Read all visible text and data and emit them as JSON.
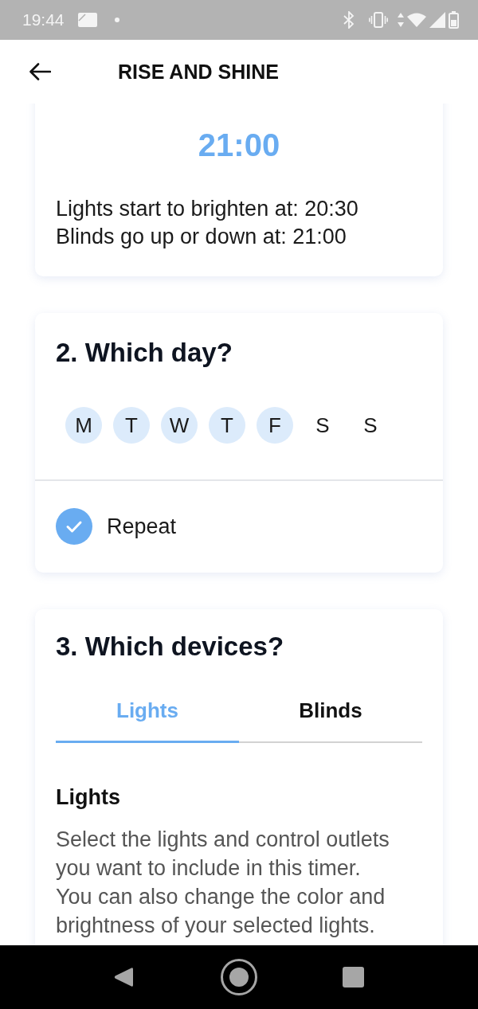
{
  "status_bar": {
    "time": "19:44"
  },
  "header": {
    "title": "RISE AND SHINE"
  },
  "time_card": {
    "time": "21:00",
    "lines": [
      "Lights start to brighten at: 20:30",
      "Blinds go up or down at: 21:00"
    ]
  },
  "day_card": {
    "title": "2. Which day?",
    "days": [
      {
        "label": "M",
        "selected": true
      },
      {
        "label": "T",
        "selected": true
      },
      {
        "label": "W",
        "selected": true
      },
      {
        "label": "T",
        "selected": true
      },
      {
        "label": "F",
        "selected": true
      },
      {
        "label": "S",
        "selected": false
      },
      {
        "label": "S",
        "selected": false
      }
    ],
    "repeat": {
      "label": "Repeat",
      "checked": true
    }
  },
  "devices_card": {
    "title": "3. Which devices?",
    "tabs": [
      {
        "label": "Lights",
        "selected": true
      },
      {
        "label": "Blinds",
        "selected": false
      }
    ],
    "panel": {
      "heading": "Lights",
      "description": "Select the lights and control outlets you want to include in this timer. You can also change the color and brightness of your selected lights."
    }
  }
}
